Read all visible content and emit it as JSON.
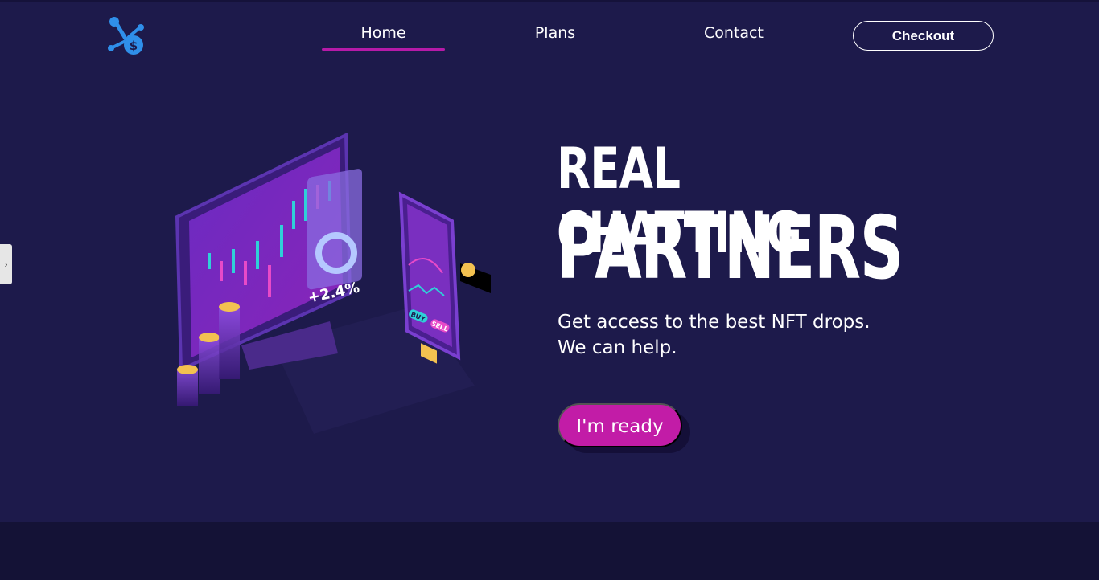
{
  "nav": {
    "links": [
      {
        "label": "Home",
        "active": true
      },
      {
        "label": "Plans",
        "active": false
      },
      {
        "label": "Contact",
        "active": false
      }
    ],
    "checkout_label": "Checkout"
  },
  "side_tab": {
    "icon": "chevron-right-icon",
    "glyph": "›"
  },
  "hero": {
    "headline_line1": "REAL CHATTING",
    "headline_line2": "PARTNERS",
    "subtitle_line1": "Get access to the best NFT drops.",
    "subtitle_line2": "We can help.",
    "cta_label": "I'm ready"
  },
  "illustration": {
    "monitor_label": "+2.4%",
    "phone_buy_label": "BUY",
    "phone_sell_label": "SELL"
  },
  "colors": {
    "background": "#1d1a4b",
    "accent": "#c21ca7",
    "logo": "#2f8fea",
    "footer": "#141236"
  }
}
